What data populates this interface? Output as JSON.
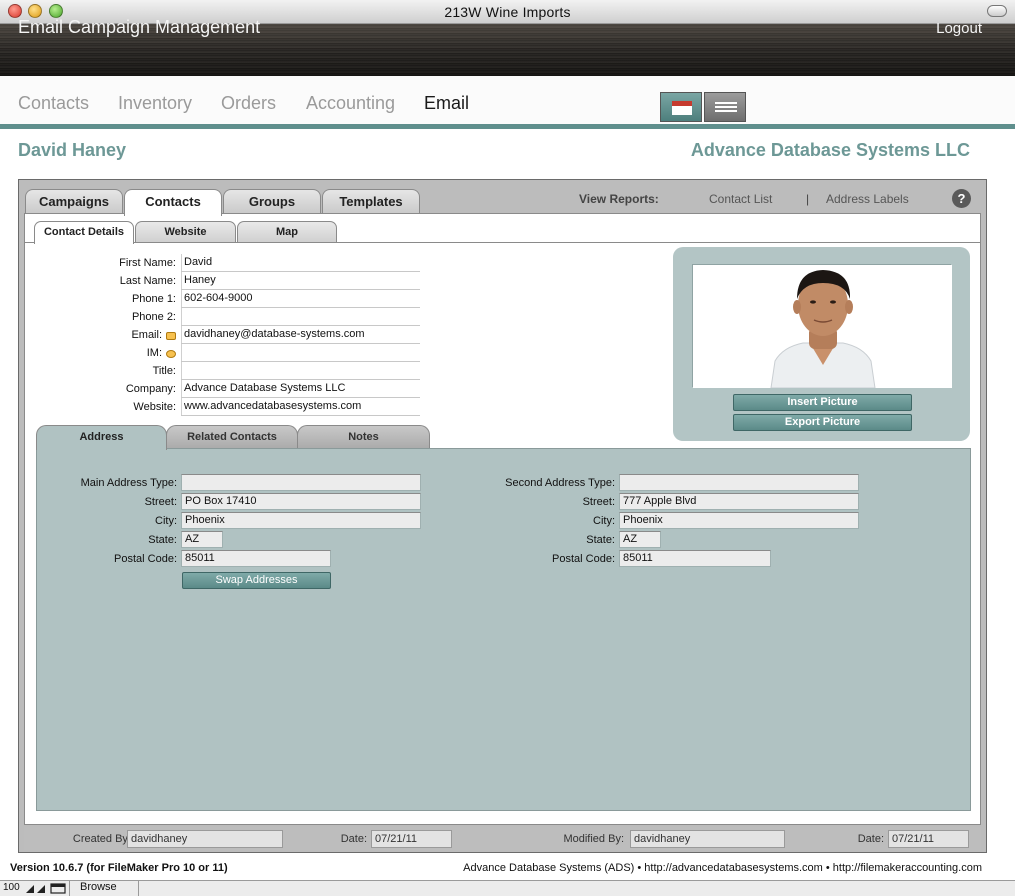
{
  "window": {
    "title": "213W Wine Imports"
  },
  "header": {
    "app_title": "Email Campaign Management",
    "logout_label": "Logout"
  },
  "nav": {
    "items": [
      {
        "label": "Contacts"
      },
      {
        "label": "Inventory"
      },
      {
        "label": "Orders"
      },
      {
        "label": "Accounting"
      },
      {
        "label": "Email"
      }
    ],
    "active": "Email"
  },
  "record": {
    "person_name": "David Haney",
    "company_name": "Advance Database Systems LLC"
  },
  "tabs": [
    "Campaigns",
    "Contacts",
    "Groups",
    "Templates"
  ],
  "active_tab": "Contacts",
  "reports": {
    "label": "View Reports:",
    "links": [
      "Contact List",
      "Address Labels"
    ],
    "separator": "|"
  },
  "help": {
    "label": "?"
  },
  "subtabs": [
    "Contact Details",
    "Website",
    "Map"
  ],
  "active_subtab": "Contact Details",
  "contact": {
    "fields": [
      {
        "label": "First Name:",
        "value": "David"
      },
      {
        "label": "Last Name:",
        "value": "Haney"
      },
      {
        "label": "Phone 1:",
        "value": "602-604-9000"
      },
      {
        "label": "Phone 2:",
        "value": ""
      },
      {
        "label": "Email:",
        "value": "davidhaney@database-systems.com"
      },
      {
        "label": "IM:",
        "value": ""
      },
      {
        "label": "Title:",
        "value": ""
      },
      {
        "label": "Company:",
        "value": "Advance Database Systems LLC"
      },
      {
        "label": "Website:",
        "value": "www.advancedatabasesystems.com"
      }
    ]
  },
  "picture": {
    "insert_label": "Insert Picture",
    "export_label": "Export Picture"
  },
  "address_tabs": [
    "Address",
    "Related Contacts",
    "Notes"
  ],
  "active_address_tab": "Address",
  "address": {
    "main": [
      {
        "label": "Main Address Type:",
        "value": ""
      },
      {
        "label": "Street:",
        "value": "PO Box 17410"
      },
      {
        "label": "City:",
        "value": "Phoenix"
      },
      {
        "label": "State:",
        "value": "AZ"
      },
      {
        "label": "Postal Code:",
        "value": "85011"
      }
    ],
    "second": [
      {
        "label": "Second Address Type:",
        "value": ""
      },
      {
        "label": "Street:",
        "value": "777 Apple Blvd"
      },
      {
        "label": "City:",
        "value": "Phoenix"
      },
      {
        "label": "State:",
        "value": "AZ"
      },
      {
        "label": "Postal Code:",
        "value": "85011"
      }
    ],
    "swap_label": "Swap Addresses"
  },
  "audit": {
    "created_by_label": "Created By:",
    "created_by": "davidhaney",
    "created_date_label": "Date:",
    "created_date": "07/21/11",
    "modified_by_label": "Modified By:",
    "modified_by": "davidhaney",
    "modified_date_label": "Date:",
    "modified_date": "07/21/11"
  },
  "footer": {
    "version": "Version 10.6.7 (for FileMaker Pro 10 or 11)",
    "credits": "Advance Database Systems (ADS) • http://advancedatabasesystems.com • http://filemakeraccounting.com"
  },
  "status": {
    "zoom": "100",
    "mode": "Browse"
  },
  "colors": {
    "accent": "#6d9896",
    "teal_bar": "#5f8f8d",
    "panel": "#b0c2c2"
  }
}
